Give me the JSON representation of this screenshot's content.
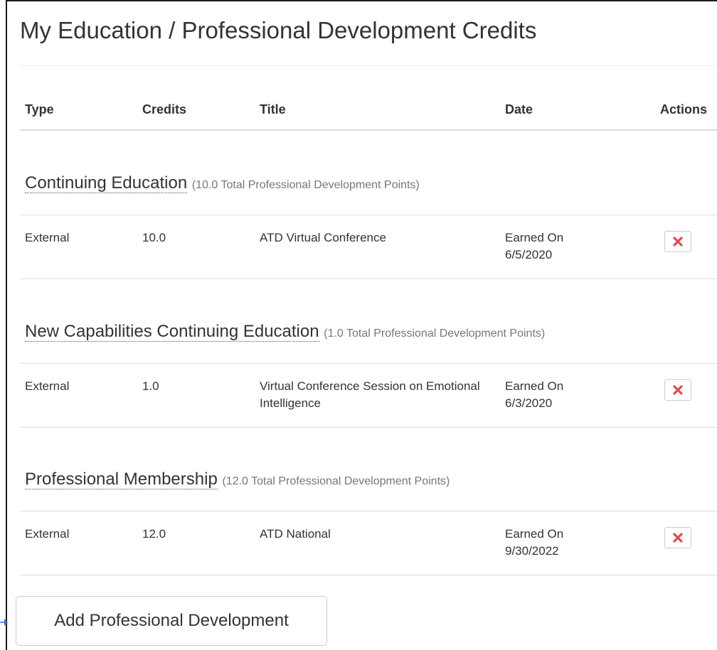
{
  "page": {
    "title": "My Education / Professional Development Credits"
  },
  "table": {
    "headers": {
      "type": "Type",
      "credits": "Credits",
      "title": "Title",
      "date": "Date",
      "actions": "Actions"
    }
  },
  "groups": [
    {
      "name": "Continuing Education",
      "total": "(10.0 Total Professional Development Points)",
      "row": {
        "type": "External",
        "credits": "10.0",
        "title": "ATD Virtual Conference",
        "date_label": "Earned On",
        "date": "6/5/2020"
      }
    },
    {
      "name": "New Capabilities Continuing Education",
      "total": "(1.0 Total Professional Development Points)",
      "row": {
        "type": "External",
        "credits": "1.0",
        "title": "Virtual Conference Session on Emotional Intelligence",
        "date_label": "Earned On",
        "date": "6/3/2020"
      }
    },
    {
      "name": "Professional Membership",
      "total": "(12.0 Total Professional Development Points)",
      "row": {
        "type": "External",
        "credits": "12.0",
        "title": "ATD National",
        "date_label": "Earned On",
        "date": "9/30/2022"
      }
    }
  ],
  "actions": {
    "add_label": "Add Professional Development",
    "delete_icon": "red-x-icon"
  },
  "colors": {
    "delete_red": "#e8474c",
    "arrow_blue": "#2f6fd0",
    "text": "#333333",
    "muted": "#777777"
  }
}
